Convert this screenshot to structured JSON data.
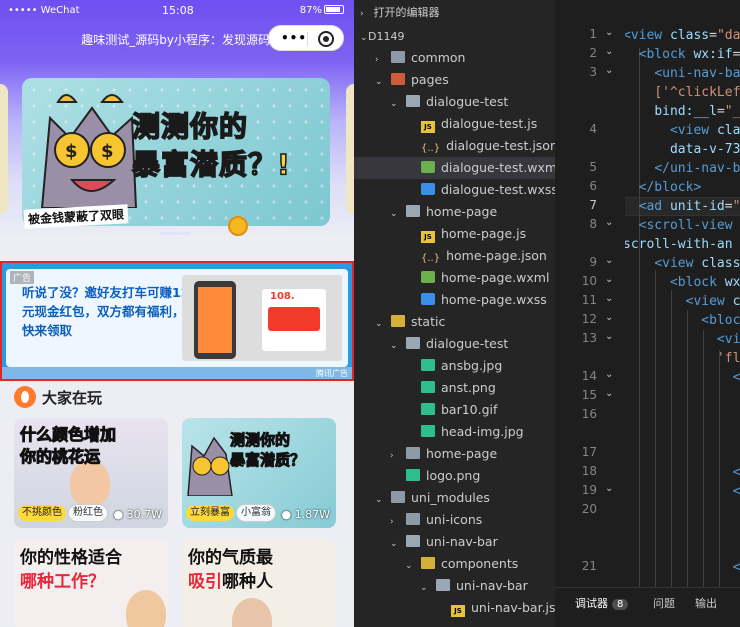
{
  "status": {
    "carrier": "••••• WeChat",
    "time": "15:08",
    "battery": "87%"
  },
  "navbar": {
    "title": "趣味测试_源码by小程序：发现源码",
    "menu_dots": "•••"
  },
  "banner": {
    "title_line1": "测测你的",
    "title_line2": "暴富潜质？!",
    "caption": "被金钱蒙蔽了双眼"
  },
  "ad": {
    "label": "广告",
    "text": "听说了没？邀好友打车可赚12元现金红包，双方都有福利，快来领取",
    "card_amount": "108.",
    "badge": "腾讯广告"
  },
  "section": {
    "title": "大家在玩"
  },
  "games": [
    {
      "title_a": "什么颜色增加",
      "title_b": "你的",
      "title_hl": "桃花运",
      "tags": [
        "不挑颜色",
        "粉红色"
      ],
      "plays": "30.7W"
    },
    {
      "title_a": "测测你的",
      "title_b": "暴富潜质？",
      "tags": [
        "立刻暴富",
        "小富翁"
      ],
      "plays": "1.87W"
    },
    {
      "title_a": "你的性格适合",
      "title_hl": "哪种工作？"
    },
    {
      "title_a": "你的气质最",
      "title_hl": "吸引",
      "title_b": "哪种人"
    }
  ],
  "tree": {
    "header": "打开的编辑器",
    "root": "D1149",
    "items": [
      {
        "label": "common",
        "indent": 1,
        "type": "folder",
        "chev": "›"
      },
      {
        "label": "pages",
        "indent": 1,
        "type": "folder-red",
        "chev": "⌄"
      },
      {
        "label": "dialogue-test",
        "indent": 2,
        "type": "folder-open",
        "chev": "⌄"
      },
      {
        "label": "dialogue-test.js",
        "indent": 3,
        "type": "js"
      },
      {
        "label": "dialogue-test.json",
        "indent": 3,
        "type": "json"
      },
      {
        "label": "dialogue-test.wxml",
        "indent": 3,
        "type": "wxml"
      },
      {
        "label": "dialogue-test.wxss",
        "indent": 3,
        "type": "wxss"
      },
      {
        "label": "home-page",
        "indent": 2,
        "type": "folder-open",
        "chev": "⌄"
      },
      {
        "label": "home-page.js",
        "indent": 3,
        "type": "js"
      },
      {
        "label": "home-page.json",
        "indent": 3,
        "type": "json"
      },
      {
        "label": "home-page.wxml",
        "indent": 3,
        "type": "wxml"
      },
      {
        "label": "home-page.wxss",
        "indent": 3,
        "type": "wxss"
      },
      {
        "label": "static",
        "indent": 1,
        "type": "folder-yellow",
        "chev": "⌄"
      },
      {
        "label": "dialogue-test",
        "indent": 2,
        "type": "folder-open",
        "chev": "⌄"
      },
      {
        "label": "ansbg.jpg",
        "indent": 3,
        "type": "img"
      },
      {
        "label": "anst.png",
        "indent": 3,
        "type": "img"
      },
      {
        "label": "bar10.gif",
        "indent": 3,
        "type": "img"
      },
      {
        "label": "head-img.jpg",
        "indent": 3,
        "type": "img"
      },
      {
        "label": "home-page",
        "indent": 2,
        "type": "folder",
        "chev": "›"
      },
      {
        "label": "logo.png",
        "indent": 2,
        "type": "img"
      },
      {
        "label": "uni_modules",
        "indent": 1,
        "type": "folder",
        "chev": "⌄"
      },
      {
        "label": "uni-icons",
        "indent": 2,
        "type": "folder",
        "chev": "›"
      },
      {
        "label": "uni-nav-bar",
        "indent": 2,
        "type": "folder-open",
        "chev": "⌄"
      },
      {
        "label": "components",
        "indent": 3,
        "type": "folder-yellow",
        "chev": "⌄"
      },
      {
        "label": "uni-nav-bar",
        "indent": 4,
        "type": "folder-open",
        "chev": "⌄"
      },
      {
        "label": "uni-nav-bar.js",
        "indent": 5,
        "type": "js"
      }
    ]
  },
  "code": {
    "lines": [
      {
        "n": "1",
        "f": "⌄",
        "html": "<span class='tg'>&lt;view</span> <span class='at'>class</span>=<span class='st'>\"dat</span>"
      },
      {
        "n": "2",
        "f": "⌄",
        "html": "  <span class='tg'>&lt;block</span> <span class='at'>wx:if</span>="
      },
      {
        "n": "3",
        "f": "⌄",
        "html": "    <span class='tg'>&lt;uni-nav-ba</span>"
      },
      {
        "n": "",
        "f": "",
        "html": "    <span class='st'>['^clickLef</span>"
      },
      {
        "n": "",
        "f": "",
        "html": "    <span class='at'>bind:__l</span>=<span class='st'>\"_</span>"
      },
      {
        "n": "4",
        "f": "",
        "html": "      <span class='tg'>&lt;view</span> <span class='at'>cla</span>"
      },
      {
        "n": "",
        "f": "",
        "html": "      <span class='at'>data-v-73</span>"
      },
      {
        "n": "5",
        "f": "",
        "html": "    <span class='tg'>&lt;/uni-nav-ba</span>"
      },
      {
        "n": "6",
        "f": "",
        "html": "  <span class='tg'>&lt;/block&gt;</span>"
      },
      {
        "n": "7",
        "f": "",
        "html": "  <span class='tg'>&lt;ad</span> <span class='at'>unit-id</span>=<span class='st'>\"</span>"
      },
      {
        "n": "8",
        "f": "⌄",
        "html": "  <span class='tg'>&lt;scroll-view</span> <span class='at'>c</span>"
      },
      {
        "n": "",
        "f": "",
        "html": "<span class='at'>scroll-with-an</span>"
      },
      {
        "n": "9",
        "f": "⌄",
        "html": "    <span class='tg'>&lt;view</span> <span class='at'>class</span>="
      },
      {
        "n": "10",
        "f": "⌄",
        "html": "      <span class='tg'>&lt;block</span> <span class='at'>wx</span>"
      },
      {
        "n": "11",
        "f": "⌄",
        "html": "        <span class='tg'>&lt;view</span> <span class='at'>c</span>"
      },
      {
        "n": "12",
        "f": "⌄",
        "html": "          <span class='tg'>&lt;block</span>"
      },
      {
        "n": "13",
        "f": "⌄",
        "html": "            <span class='tg'>&lt;vi</span>"
      },
      {
        "n": "",
        "f": "",
        "html": "            <span class='st'>'fl</span>"
      },
      {
        "n": "14",
        "f": "⌄",
        "html": "              <span class='tg'>&lt;</span>"
      },
      {
        "n": "15",
        "f": "⌄",
        "html": ""
      },
      {
        "n": "16",
        "f": "",
        "html": ""
      },
      {
        "n": "",
        "f": "",
        "html": ""
      },
      {
        "n": "17",
        "f": "",
        "html": ""
      },
      {
        "n": "18",
        "f": "",
        "html": "              <span class='tg'>&lt;</span>"
      },
      {
        "n": "19",
        "f": "⌄",
        "html": "              <span class='tg'>&lt;</span>"
      },
      {
        "n": "20",
        "f": "",
        "html": ""
      },
      {
        "n": "",
        "f": "",
        "html": ""
      },
      {
        "n": "",
        "f": "",
        "html": ""
      },
      {
        "n": "21",
        "f": "",
        "html": "              <span class='tg'>&lt;</span>"
      }
    ]
  },
  "panel": {
    "tabs": [
      "调试器",
      "问题",
      "输出"
    ],
    "badge": "8"
  }
}
